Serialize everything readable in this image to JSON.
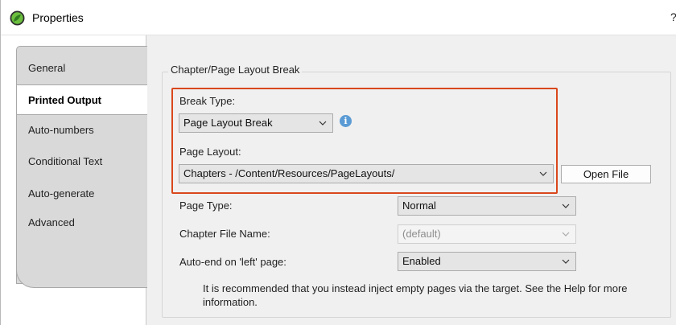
{
  "window": {
    "title": "Properties",
    "help_glyph": "?"
  },
  "tabs": [
    {
      "label": "General",
      "active": false
    },
    {
      "label": "Printed Output",
      "active": true
    },
    {
      "label": "Auto-numbers",
      "active": false
    },
    {
      "label": "Conditional Text",
      "active": false
    },
    {
      "label": "Auto-generate",
      "active": false
    },
    {
      "label": "Advanced",
      "active": false
    }
  ],
  "group": {
    "legend": "Chapter/Page Layout Break",
    "break_type": {
      "label": "Break Type:",
      "value": "Page Layout Break"
    },
    "page_layout": {
      "label": "Page Layout:",
      "value": "Chapters - /Content/Resources/PageLayouts/"
    },
    "open_file_label": "Open File",
    "page_type": {
      "label": "Page Type:",
      "value": "Normal"
    },
    "chapter_file_name": {
      "label": "Chapter File Name:",
      "value": "(default)"
    },
    "auto_end": {
      "label": "Auto-end on 'left' page:",
      "value": "Enabled"
    },
    "note": "It is recommended that you instead inject empty pages via the target.  See the Help for more information."
  },
  "colors": {
    "highlight": "#d9481c",
    "info": "#5b9bd5",
    "app_icon": "#4caf50"
  },
  "icons": {
    "app": "app-leaf-icon",
    "info": "info-icon",
    "chevron": "chevron-down-icon"
  }
}
